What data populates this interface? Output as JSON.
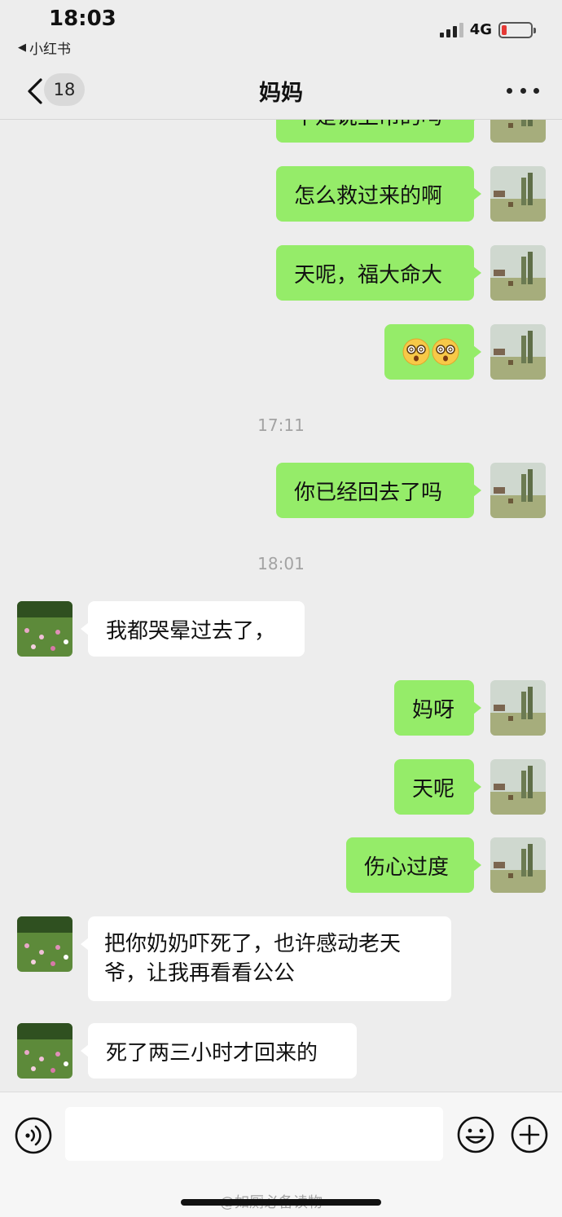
{
  "status_bar": {
    "time": "18:03",
    "back_app": "小红书",
    "network": "4G",
    "battery_level": 0.18
  },
  "nav": {
    "unread_count": "18",
    "title": "妈妈"
  },
  "messages": [
    {
      "from": "me",
      "text": "不是说上吊的吗"
    },
    {
      "from": "me",
      "text": "怎么救过来的啊"
    },
    {
      "from": "me",
      "text": "天呢，福大命大"
    },
    {
      "from": "me",
      "emoji": [
        "dizzy-face-icon",
        "dizzy-face-icon"
      ]
    },
    {
      "timestamp": "17:11"
    },
    {
      "from": "me",
      "text": "你已经回去了吗"
    },
    {
      "timestamp": "18:01"
    },
    {
      "from": "them",
      "text": "我都哭晕过去了，"
    },
    {
      "from": "me",
      "text": "妈呀"
    },
    {
      "from": "me",
      "text": "天呢"
    },
    {
      "from": "me",
      "text": "伤心过度"
    },
    {
      "from": "them",
      "text": "把你奶奶吓死了，也许感动老天爷，让我再看看公公"
    },
    {
      "from": "them",
      "text": "死了两三小时才回来的"
    }
  ],
  "input": {
    "value": "",
    "placeholder": ""
  },
  "watermark": "@如厕必备读物",
  "colors": {
    "my_bubble": "#95ec69",
    "their_bubble": "#ffffff",
    "background": "#ededed",
    "battery_low": "#e53935"
  }
}
